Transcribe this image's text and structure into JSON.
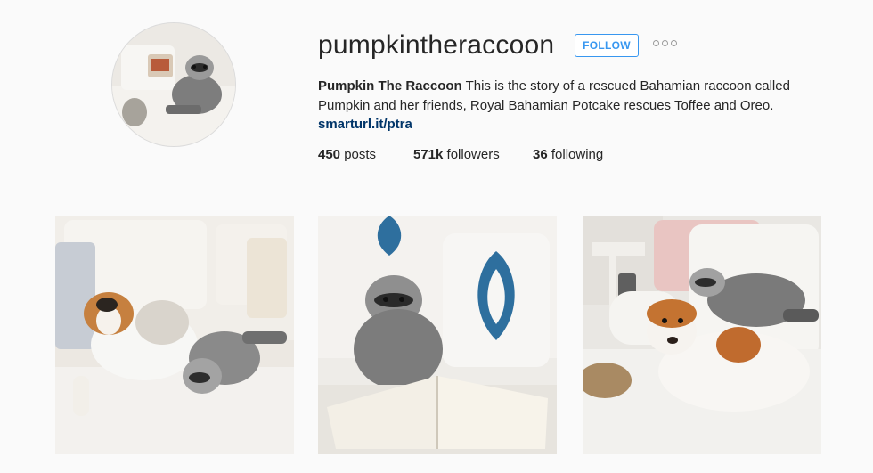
{
  "profile": {
    "username": "pumpkintheraccoon",
    "follow_label": "FOLLOW",
    "more_icon": "ellipsis-icon",
    "bio_name": "Pumpkin The Raccoon",
    "bio_text": " This is the story of a rescued Bahamian raccoon called Pumpkin and her friends, Royal Bahamian Potcake rescues Toffee and Oreo.",
    "bio_link": "smarturl.it/ptra"
  },
  "stats": {
    "posts_count": "450",
    "posts_label": " posts",
    "followers_count": "571k",
    "followers_label": " followers",
    "following_count": "36",
    "following_label": " following"
  },
  "colors": {
    "accent": "#3897f0",
    "link": "#003569",
    "background": "#fafafa"
  }
}
